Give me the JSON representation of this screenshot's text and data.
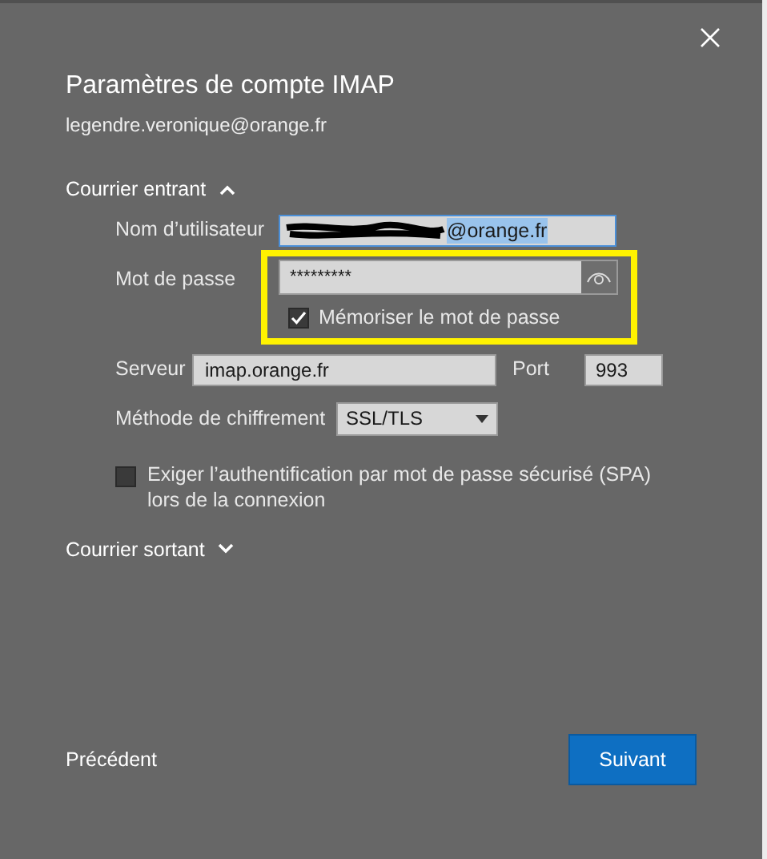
{
  "dialog": {
    "title": "Paramètres de compte IMAP",
    "subtitle": "legendre.veronique@orange.fr"
  },
  "incoming": {
    "label": "Courrier entrant",
    "expanded": true,
    "username": {
      "label": "Nom d’utilisateur",
      "value": "@orange.fr",
      "selected": true
    },
    "password": {
      "label": "Mot de passe",
      "value": "*********"
    },
    "remember": {
      "label": "Mémoriser le mot de passe",
      "checked": true
    },
    "server": {
      "label": "Serveur",
      "value": "imap.orange.fr"
    },
    "port": {
      "label": "Port",
      "value": "993"
    },
    "encryption": {
      "label": "Méthode de chiffrement",
      "value": "SSL/TLS"
    },
    "spa": {
      "label": "Exiger l’authentification par mot de passe sécurisé (SPA) lors de la connexion",
      "checked": false
    }
  },
  "outgoing": {
    "label": "Courrier sortant",
    "expanded": false
  },
  "buttons": {
    "back": "Précédent",
    "next": "Suivant"
  }
}
